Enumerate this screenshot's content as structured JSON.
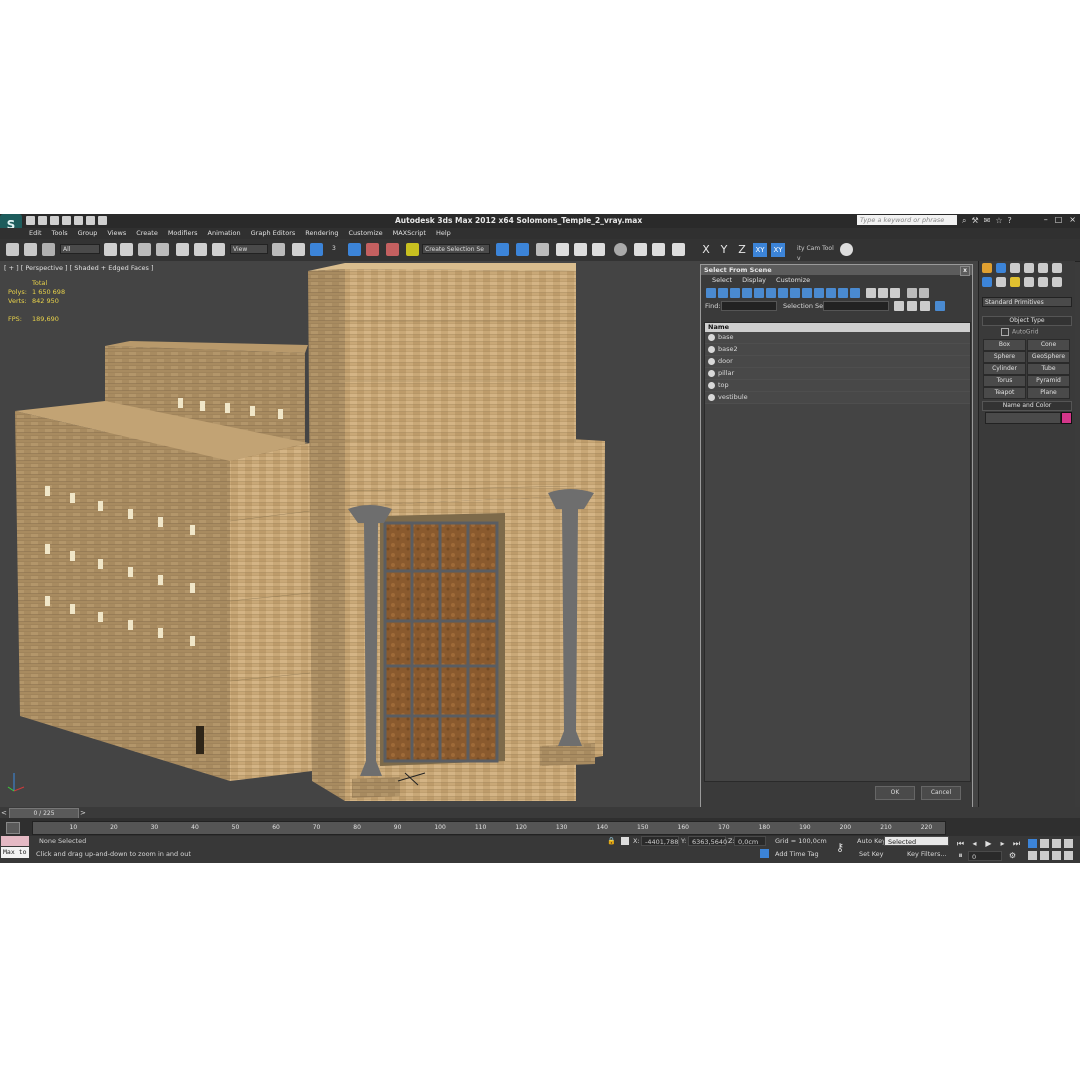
{
  "app": {
    "title": "Autodesk 3ds Max  2012 x64     Solomons_Temple_2_vray.max",
    "search_placeholder": "Type a keyword or phrase",
    "logo_glyph": "S"
  },
  "menu": [
    "Edit",
    "Tools",
    "Group",
    "Views",
    "Create",
    "Modifiers",
    "Animation",
    "Graph Editors",
    "Rendering",
    "Customize",
    "MAXScript",
    "Help"
  ],
  "toolbar": {
    "filter_select": "All",
    "ref_coord_select": "View",
    "selection_set_select": "Create Selection Se",
    "snap_label": "3",
    "axis_x": "X",
    "axis_y": "Y",
    "axis_z": "Z",
    "axis_xy": "XY",
    "axis_xy2": "XY",
    "extra_tool": "ity Cam Tool v"
  },
  "viewport": {
    "label": "[ + ] [ Perspective ] [ Shaded + Edged Faces ]",
    "stats_total": "Total",
    "polys_label": "Polys:",
    "polys_value": "1 650 698",
    "verts_label": "Verts:",
    "verts_value": "842 950",
    "fps_label": "FPS:",
    "fps_value": "189,690"
  },
  "dialog": {
    "title": "Select From Scene",
    "close": "x",
    "menu": [
      "Select",
      "Display",
      "Customize"
    ],
    "find_label": "Find:",
    "selection_set_label": "Selection Set:",
    "column_name": "Name",
    "objects": [
      "base",
      "base2",
      "door",
      "pillar",
      "top",
      "vestibule"
    ],
    "ok_label": "OK",
    "cancel_label": "Cancel"
  },
  "command_panel": {
    "category": "Standard Primitives",
    "object_type_header": "Object Type",
    "autogrid_label": "AutoGrid",
    "primitives": [
      "Box",
      "Cone",
      "Sphere",
      "GeoSphere",
      "Cylinder",
      "Tube",
      "Torus",
      "Pyramid",
      "Teapot",
      "Plane"
    ],
    "name_color_header": "Name and Color",
    "swatch_color": "#d4368a"
  },
  "timeline": {
    "slider_label": "0 / 225",
    "ticks": [
      "10",
      "20",
      "30",
      "40",
      "50",
      "60",
      "70",
      "80",
      "90",
      "100",
      "110",
      "120",
      "130",
      "140",
      "150",
      "160",
      "170",
      "180",
      "190",
      "200",
      "210",
      "220"
    ]
  },
  "status": {
    "maxscript": "Max to",
    "selection": "None Selected",
    "prompt": "Click and drag up-and-down to zoom in and out",
    "x_label": "X:",
    "x_value": "-4401,788",
    "y_label": "Y:",
    "y_value": "6363,5640",
    "z_label": "Z:",
    "z_value": "0,0cm",
    "grid": "Grid = 100,0cm",
    "add_time_tag": "Add Time Tag",
    "auto_key": "Auto Key",
    "set_key": "Set Key",
    "key_mode": "Selected",
    "key_filters": "Key Filters...",
    "frame": "0"
  },
  "colors": {
    "accent": "#3c84d8",
    "stats": "#e8d24a",
    "stone": "#c9a877",
    "door": "#8a5a2e",
    "pillar": "#6e6e6e"
  }
}
